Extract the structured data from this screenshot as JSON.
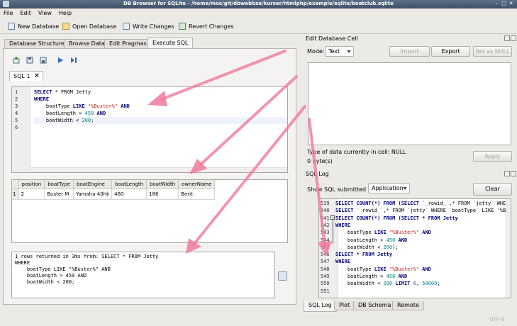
{
  "window": {
    "title": "DB Browser for SQLite - /home/mos/git/dbwebbse/kurser/htmlphp/example/sqlite/boatclub.sqlite"
  },
  "menu": [
    "File",
    "Edit",
    "View",
    "Help"
  ],
  "toolbar": {
    "new_database": "New Database",
    "open_database": "Open Database",
    "write_changes": "Write Changes",
    "revert_changes": "Revert Changes"
  },
  "tabs": [
    "Database Structure",
    "Browse Data",
    "Edit Pragmas",
    "Execute SQL"
  ],
  "sql_tab": "SQL 1",
  "editor": {
    "line_numbers": [
      "1",
      "2",
      "3",
      "4",
      "5",
      "6"
    ],
    "line1": {
      "kw": "SELECT",
      "rest": " * FROM Jetty"
    },
    "line2": {
      "kw": "WHERE"
    },
    "line3": {
      "pre": "    boatType ",
      "kw": "LIKE",
      "str": "\"%Buster%\"",
      "kw2": " AND"
    },
    "line4": {
      "pre": "    boatLength > ",
      "num": "450",
      "kw": " AND"
    },
    "line5": {
      "pre": "    boatWidth < ",
      "num": "200",
      "post": ";"
    }
  },
  "results": {
    "columns": [
      "position",
      "boatType",
      "boatEngine",
      "boatLength",
      "boatWidth",
      "ownerName"
    ],
    "row_number": "1",
    "row": [
      "2",
      "Buster M",
      "Yamaha 40hk",
      "460",
      "186",
      "Berit"
    ]
  },
  "message": "1 rows returned in 3ms from: SELECT * FROM Jetty\nWHERE\n    boatType LIKE \"%Buster%\" AND\n    boatLength > 450 AND\n    boatWidth < 200;",
  "edit_cell": {
    "title": "Edit Database Cell",
    "mode_label": "Mode:",
    "mode_value": "Text",
    "import": "Import",
    "export": "Export",
    "set_null": "Set as NULL",
    "type_info": "Type of data currently in cell: NULL",
    "size_info": "0 byte(s)",
    "apply": "Apply"
  },
  "sql_log": {
    "title": "SQL Log",
    "show_label": "Show SQL submitted by",
    "submitter": "Application",
    "clear": "Clear",
    "line_numbers": [
      "539",
      "540",
      "541",
      "542",
      "543",
      "544",
      "545",
      "546",
      "547",
      "548",
      "549",
      "550",
      "551"
    ],
    "l539": {
      "kw": "SELECT COUNT(*) FROM (SELECT",
      "rest": " `_rowid_`,* FROM `jetty` WHERE"
    },
    "l540": {
      "kw": "SELECT",
      "rest": " `_rowid_`,* FROM `jetty` WHERE `boatType` LIKE '%Bu"
    },
    "l541": {
      "kw": "SELECT COUNT(*) FROM (SELECT * FROM Jetty"
    },
    "l542": {
      "kw": "WHERE"
    },
    "l543": {
      "pre": "    boatType ",
      "kw": "LIKE",
      "str": " \"%Buster%\"",
      "kw2": " AND"
    },
    "l544": {
      "pre": "    boatLength > ",
      "num": "450",
      "kw": " AND"
    },
    "l545": {
      "pre": "    boatWidth < ",
      "num": "200",
      "post": ");"
    },
    "l546": {
      "kw": "SELECT * FROM Jetty"
    },
    "l547": {
      "kw": "WHERE"
    },
    "l548": {
      "pre": "    boatType ",
      "kw": "LIKE",
      "str": " \"%Buster%\"",
      "kw2": " AND"
    },
    "l549": {
      "pre": "    boatLength > ",
      "num": "450",
      "kw": " AND"
    },
    "l550": {
      "pre": "    boatWidth < ",
      "num": "200",
      "kw": " LIMIT",
      "num2": " 0",
      "post": ", ",
      "num3": "50000",
      "post2": ";"
    }
  },
  "bottom_tabs": [
    "SQL Log",
    "Plot",
    "DB Schema",
    "Remote"
  ],
  "status": {
    "encoding": "UTF-8"
  }
}
